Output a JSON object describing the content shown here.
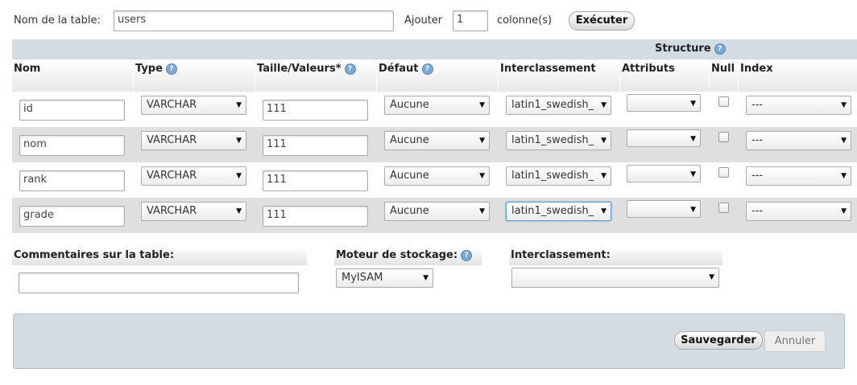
{
  "top": {
    "table_name_label": "Nom de la table:",
    "table_name_value": "users",
    "add_label": "Ajouter",
    "add_count": "1",
    "columns_label": "colonne(s)",
    "execute_button": "Exécuter"
  },
  "structure": {
    "title": "Structure",
    "headers": {
      "nom": "Nom",
      "type": "Type",
      "taille": "Taille/Valeurs*",
      "defaut": "Défaut",
      "interclassement": "Interclassement",
      "attributs": "Attributs",
      "null": "Null",
      "index": "Index"
    },
    "rows": [
      {
        "name": "id",
        "type": "VARCHAR",
        "size": "111",
        "default": "Aucune",
        "collation": "latin1_swedish_",
        "attributes": "",
        "null": false,
        "index": "---"
      },
      {
        "name": "nom",
        "type": "VARCHAR",
        "size": "111",
        "default": "Aucune",
        "collation": "latin1_swedish_",
        "attributes": "",
        "null": false,
        "index": "---"
      },
      {
        "name": "rank",
        "type": "VARCHAR",
        "size": "111",
        "default": "Aucune",
        "collation": "latin1_swedish_",
        "attributes": "",
        "null": false,
        "index": "---"
      },
      {
        "name": "grade",
        "type": "VARCHAR",
        "size": "111",
        "default": "Aucune",
        "collation": "latin1_swedish_",
        "attributes": "",
        "null": false,
        "index": "---"
      }
    ]
  },
  "options": {
    "comments_label": "Commentaires sur la table:",
    "comments_value": "",
    "engine_label": "Moteur de stockage:",
    "engine_value": "MyISAM",
    "collation_label": "Interclassement:",
    "collation_value": ""
  },
  "footer": {
    "save_button": "Sauvegarder",
    "cancel_button": "Annuler"
  },
  "icons": {
    "help": "question-mark-icon",
    "dropdown": "triangle-down-icon"
  },
  "colors": {
    "header_band": "#d3dbe3",
    "even_row": "#dfdfdf",
    "help_icon": "#7ba7d7"
  }
}
